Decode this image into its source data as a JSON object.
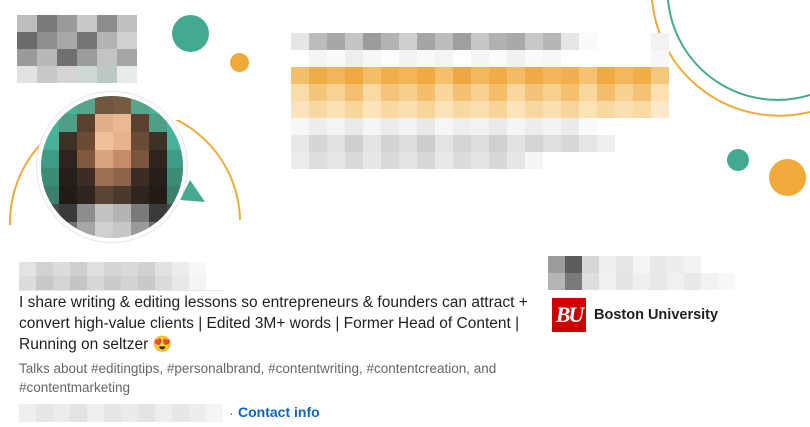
{
  "colors": {
    "teal": "#43a98f",
    "orange": "#f0aa3a",
    "link_blue": "#0a66c2",
    "bu_red": "#cc0000"
  },
  "profile": {
    "headline": "I share writing & editing lessons so entrepreneurs & founders can attract + convert high-value clients | Edited 3M+ words | Former Head of Content | Running on seltzer 😍",
    "talks_about": "Talks about #editingtips, #personalbrand, #contentwriting, #contentcreation, and #contentmarketing",
    "contact_info_label": "Contact info",
    "separator": "·"
  },
  "education": {
    "logo_text": "BU",
    "name": "Boston University"
  }
}
